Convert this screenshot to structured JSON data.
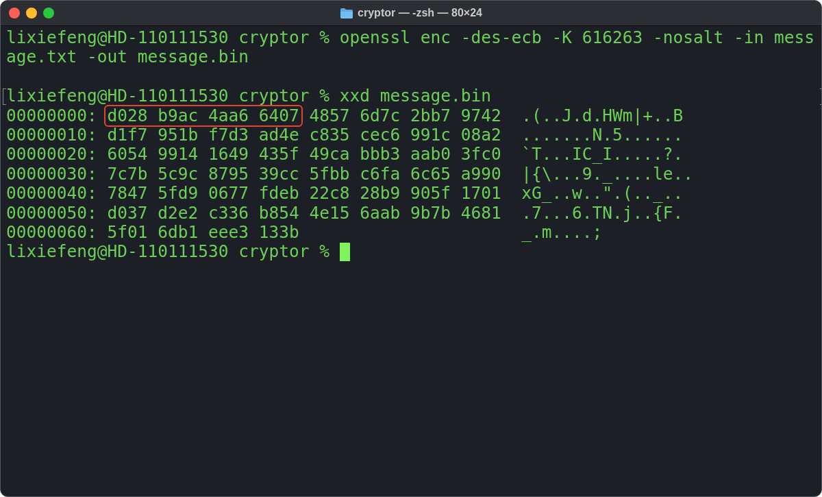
{
  "window": {
    "title": "cryptor — -zsh — 80×24"
  },
  "terminal": {
    "lines": [
      {
        "kind": "text",
        "segments": [
          {
            "text": "lixiefeng@HD-110111530 cryptor % openssl enc -des-ecb -K 616263 -nosalt -in mess",
            "highlighted": false
          }
        ]
      },
      {
        "kind": "text",
        "segments": [
          {
            "text": "age.txt -out message.bin",
            "highlighted": false
          }
        ]
      },
      {
        "kind": "blank"
      },
      {
        "kind": "text",
        "segments": [
          {
            "text": "lixiefeng@HD-110111530 cryptor % xxd message.bin",
            "highlighted": false
          }
        ],
        "marked": true
      },
      {
        "kind": "text",
        "segments": [
          {
            "text": "00000000: ",
            "highlighted": false
          },
          {
            "text": "d028 b9ac 4aa6 6407",
            "highlighted": true
          },
          {
            "text": " 4857 6d7c 2bb7 9742  .(..J.d.HWm|+..B",
            "highlighted": false
          }
        ]
      },
      {
        "kind": "text",
        "segments": [
          {
            "text": "00000010: d1f7 951b f7d3 ad4e c835 cec6 991c 08a2  .......N.5......",
            "highlighted": false
          }
        ]
      },
      {
        "kind": "text",
        "segments": [
          {
            "text": "00000020: 6054 9914 1649 435f 49ca bbb3 aab0 3fc0  `T...IC_I.....?.",
            "highlighted": false
          }
        ]
      },
      {
        "kind": "text",
        "segments": [
          {
            "text": "00000030: 7c7b 5c9c 8795 39cc 5fbb c6fa 6c65 a990  |{\\...9._....le..",
            "highlighted": false
          }
        ]
      },
      {
        "kind": "text",
        "segments": [
          {
            "text": "00000040: 7847 5fd9 0677 fdeb 22c8 28b9 905f 1701  xG_..w..\".(.._..",
            "highlighted": false
          }
        ]
      },
      {
        "kind": "text",
        "segments": [
          {
            "text": "00000050: d037 d2e2 c336 b854 4e15 6aab 9b7b 4681  .7...6.TN.j..{F.",
            "highlighted": false
          }
        ]
      },
      {
        "kind": "text",
        "segments": [
          {
            "text": "00000060: 5f01 6db1 eee3 133b                      _.m....;",
            "highlighted": false
          }
        ]
      },
      {
        "kind": "text",
        "segments": [
          {
            "text": "lixiefeng@HD-110111530 cryptor % ",
            "highlighted": false
          }
        ],
        "cursor": true
      }
    ]
  }
}
